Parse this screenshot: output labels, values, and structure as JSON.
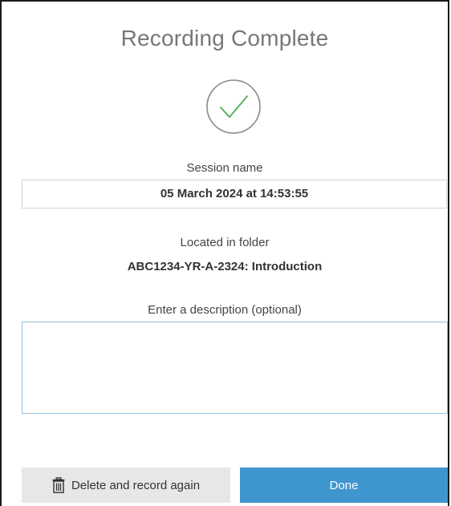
{
  "dialog": {
    "title": "Recording Complete",
    "status_icon": "checkmark-circle-icon",
    "accent_color": "#4caf50"
  },
  "session": {
    "label": "Session name",
    "value": "05 March 2024 at 14:53:55"
  },
  "folder": {
    "label": "Located in folder",
    "value": "ABC1234-YR-A-2324: Introduction"
  },
  "description": {
    "label": "Enter a description (optional)",
    "value": "",
    "focus_border_color": "#8fc1dc"
  },
  "buttons": {
    "delete_label": "Delete and record again",
    "delete_icon": "trash-icon",
    "done_label": "Done",
    "done_color": "#3f96cf"
  }
}
